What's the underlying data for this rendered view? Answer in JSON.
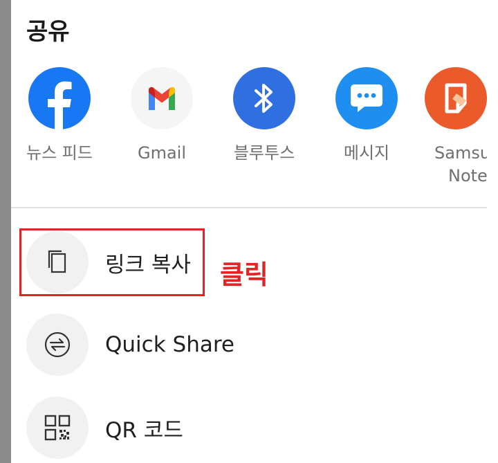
{
  "sheet": {
    "title": "공유"
  },
  "apps": [
    {
      "label": "뉴스 피드",
      "icon": "facebook-icon",
      "color": "#1877f2"
    },
    {
      "label": "Gmail",
      "icon": "gmail-icon",
      "color": "#f5f5f5"
    },
    {
      "label": "블루투스",
      "icon": "bluetooth-icon",
      "color": "#2f6fe0"
    },
    {
      "label": "메시지",
      "icon": "messages-icon",
      "color": "#1e8ff0"
    },
    {
      "label_line1": "Samsu",
      "label_line2": "Note",
      "icon": "samsung-notes-icon",
      "color": "#ea5a2a"
    }
  ],
  "actions": [
    {
      "label": "링크 복사",
      "icon": "copy-link-icon"
    },
    {
      "label": "Quick Share",
      "icon": "quick-share-icon"
    },
    {
      "label": "QR 코드",
      "icon": "qr-code-icon"
    }
  ],
  "annotation": {
    "text": "클릭",
    "color": "#e02424"
  }
}
